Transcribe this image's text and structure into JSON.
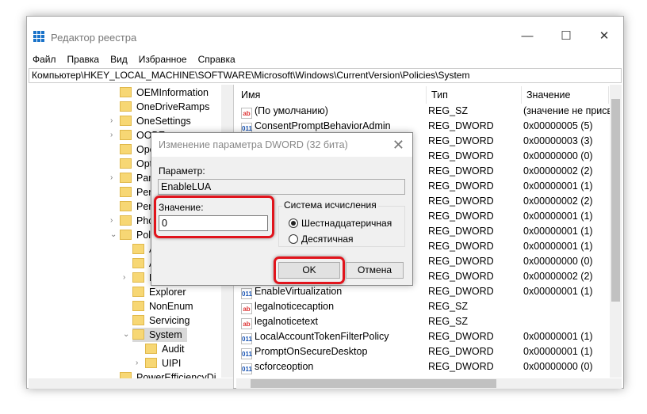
{
  "window": {
    "title": "Редактор реестра",
    "minimize": "—",
    "maximize": "☐",
    "close": "✕"
  },
  "menu": [
    "Файл",
    "Правка",
    "Вид",
    "Избранное",
    "Справка"
  ],
  "address": "Компьютер\\HKEY_LOCAL_MACHINE\\SOFTWARE\\Microsoft\\Windows\\CurrentVersion\\Policies\\System",
  "tree": [
    {
      "label": "OEMInformation",
      "level": 1,
      "arrow": false
    },
    {
      "label": "OneDriveRamps",
      "level": 1,
      "arrow": false
    },
    {
      "label": "OneSettings",
      "level": 1,
      "arrow": true
    },
    {
      "label": "OOBE",
      "level": 1,
      "arrow": true
    },
    {
      "label": "Ope",
      "level": 1,
      "arrow": false
    },
    {
      "label": "Opt",
      "level": 1,
      "arrow": false
    },
    {
      "label": "Parc",
      "level": 1,
      "arrow": true
    },
    {
      "label": "Perc",
      "level": 1,
      "arrow": false
    },
    {
      "label": "Pers",
      "level": 1,
      "arrow": false
    },
    {
      "label": "Phc",
      "level": 1,
      "arrow": true
    },
    {
      "label": "Poli",
      "level": 1,
      "arrow": "open"
    },
    {
      "label": "A",
      "level": 2,
      "arrow": false
    },
    {
      "label": "A",
      "level": 2,
      "arrow": false
    },
    {
      "label": "D",
      "level": 2,
      "arrow": true
    },
    {
      "label": "Explorer",
      "level": 2,
      "arrow": false
    },
    {
      "label": "NonEnum",
      "level": 2,
      "arrow": false
    },
    {
      "label": "Servicing",
      "level": 2,
      "arrow": false
    },
    {
      "label": "System",
      "level": 2,
      "arrow": "open",
      "selected": true
    },
    {
      "label": "Audit",
      "level": 3,
      "arrow": false
    },
    {
      "label": "UIPI",
      "level": 3,
      "arrow": true
    },
    {
      "label": "PowerEfficiencyDi",
      "level": 1,
      "arrow": false
    }
  ],
  "columns": {
    "name": "Имя",
    "type": "Тип",
    "value": "Значение"
  },
  "values": [
    {
      "icon": "string",
      "name": "(По умолчанию)",
      "type": "REG_SZ",
      "value": "(значение не присвоено)"
    },
    {
      "icon": "dword",
      "name": "ConsentPromptBehaviorAdmin",
      "type": "REG_DWORD",
      "value": "0x00000005 (5)"
    },
    {
      "icon": "dword",
      "name": "",
      "type": "REG_DWORD",
      "value": "0x00000003 (3)"
    },
    {
      "icon": "dword",
      "name": "",
      "type": "REG_DWORD",
      "value": "0x00000000 (0)"
    },
    {
      "icon": "dword",
      "name": "",
      "type": "REG_DWORD",
      "value": "0x00000002 (2)"
    },
    {
      "icon": "dword",
      "name": "",
      "type": "REG_DWORD",
      "value": "0x00000001 (1)"
    },
    {
      "icon": "dword",
      "name": "",
      "type": "REG_DWORD",
      "value": "0x00000002 (2)"
    },
    {
      "icon": "dword",
      "name": "",
      "type": "REG_DWORD",
      "value": "0x00000001 (1)"
    },
    {
      "icon": "dword",
      "name": "",
      "type": "REG_DWORD",
      "value": "0x00000001 (1)"
    },
    {
      "icon": "dword",
      "name": "",
      "type": "REG_DWORD",
      "value": "0x00000001 (1)"
    },
    {
      "icon": "dword",
      "name": "",
      "type": "REG_DWORD",
      "value": "0x00000000 (0)"
    },
    {
      "icon": "dword",
      "name": "",
      "type": "REG_DWORD",
      "value": "0x00000002 (2)"
    },
    {
      "icon": "dword",
      "name": "EnableVirtualization",
      "type": "REG_DWORD",
      "value": "0x00000001 (1)"
    },
    {
      "icon": "string",
      "name": "legalnoticecaption",
      "type": "REG_SZ",
      "value": ""
    },
    {
      "icon": "string",
      "name": "legalnoticetext",
      "type": "REG_SZ",
      "value": ""
    },
    {
      "icon": "dword",
      "name": "LocalAccountTokenFilterPolicy",
      "type": "REG_DWORD",
      "value": "0x00000001 (1)"
    },
    {
      "icon": "dword",
      "name": "PromptOnSecureDesktop",
      "type": "REG_DWORD",
      "value": "0x00000001 (1)"
    },
    {
      "icon": "dword",
      "name": "scforceoption",
      "type": "REG_DWORD",
      "value": "0x00000000 (0)"
    }
  ],
  "dialog": {
    "title": "Изменение параметра DWORD (32 бита)",
    "param_label": "Параметр:",
    "param_value": "EnableLUA",
    "value_label": "Значение:",
    "value": "0",
    "base_group": "Система исчисления",
    "hex": "Шестнадцатеричная",
    "dec": "Десятичная",
    "selected_base": "hex",
    "ok": "OK",
    "cancel": "Отмена"
  },
  "colors": {
    "highlight": "#e1141c",
    "selection": "#d9d9d9"
  }
}
